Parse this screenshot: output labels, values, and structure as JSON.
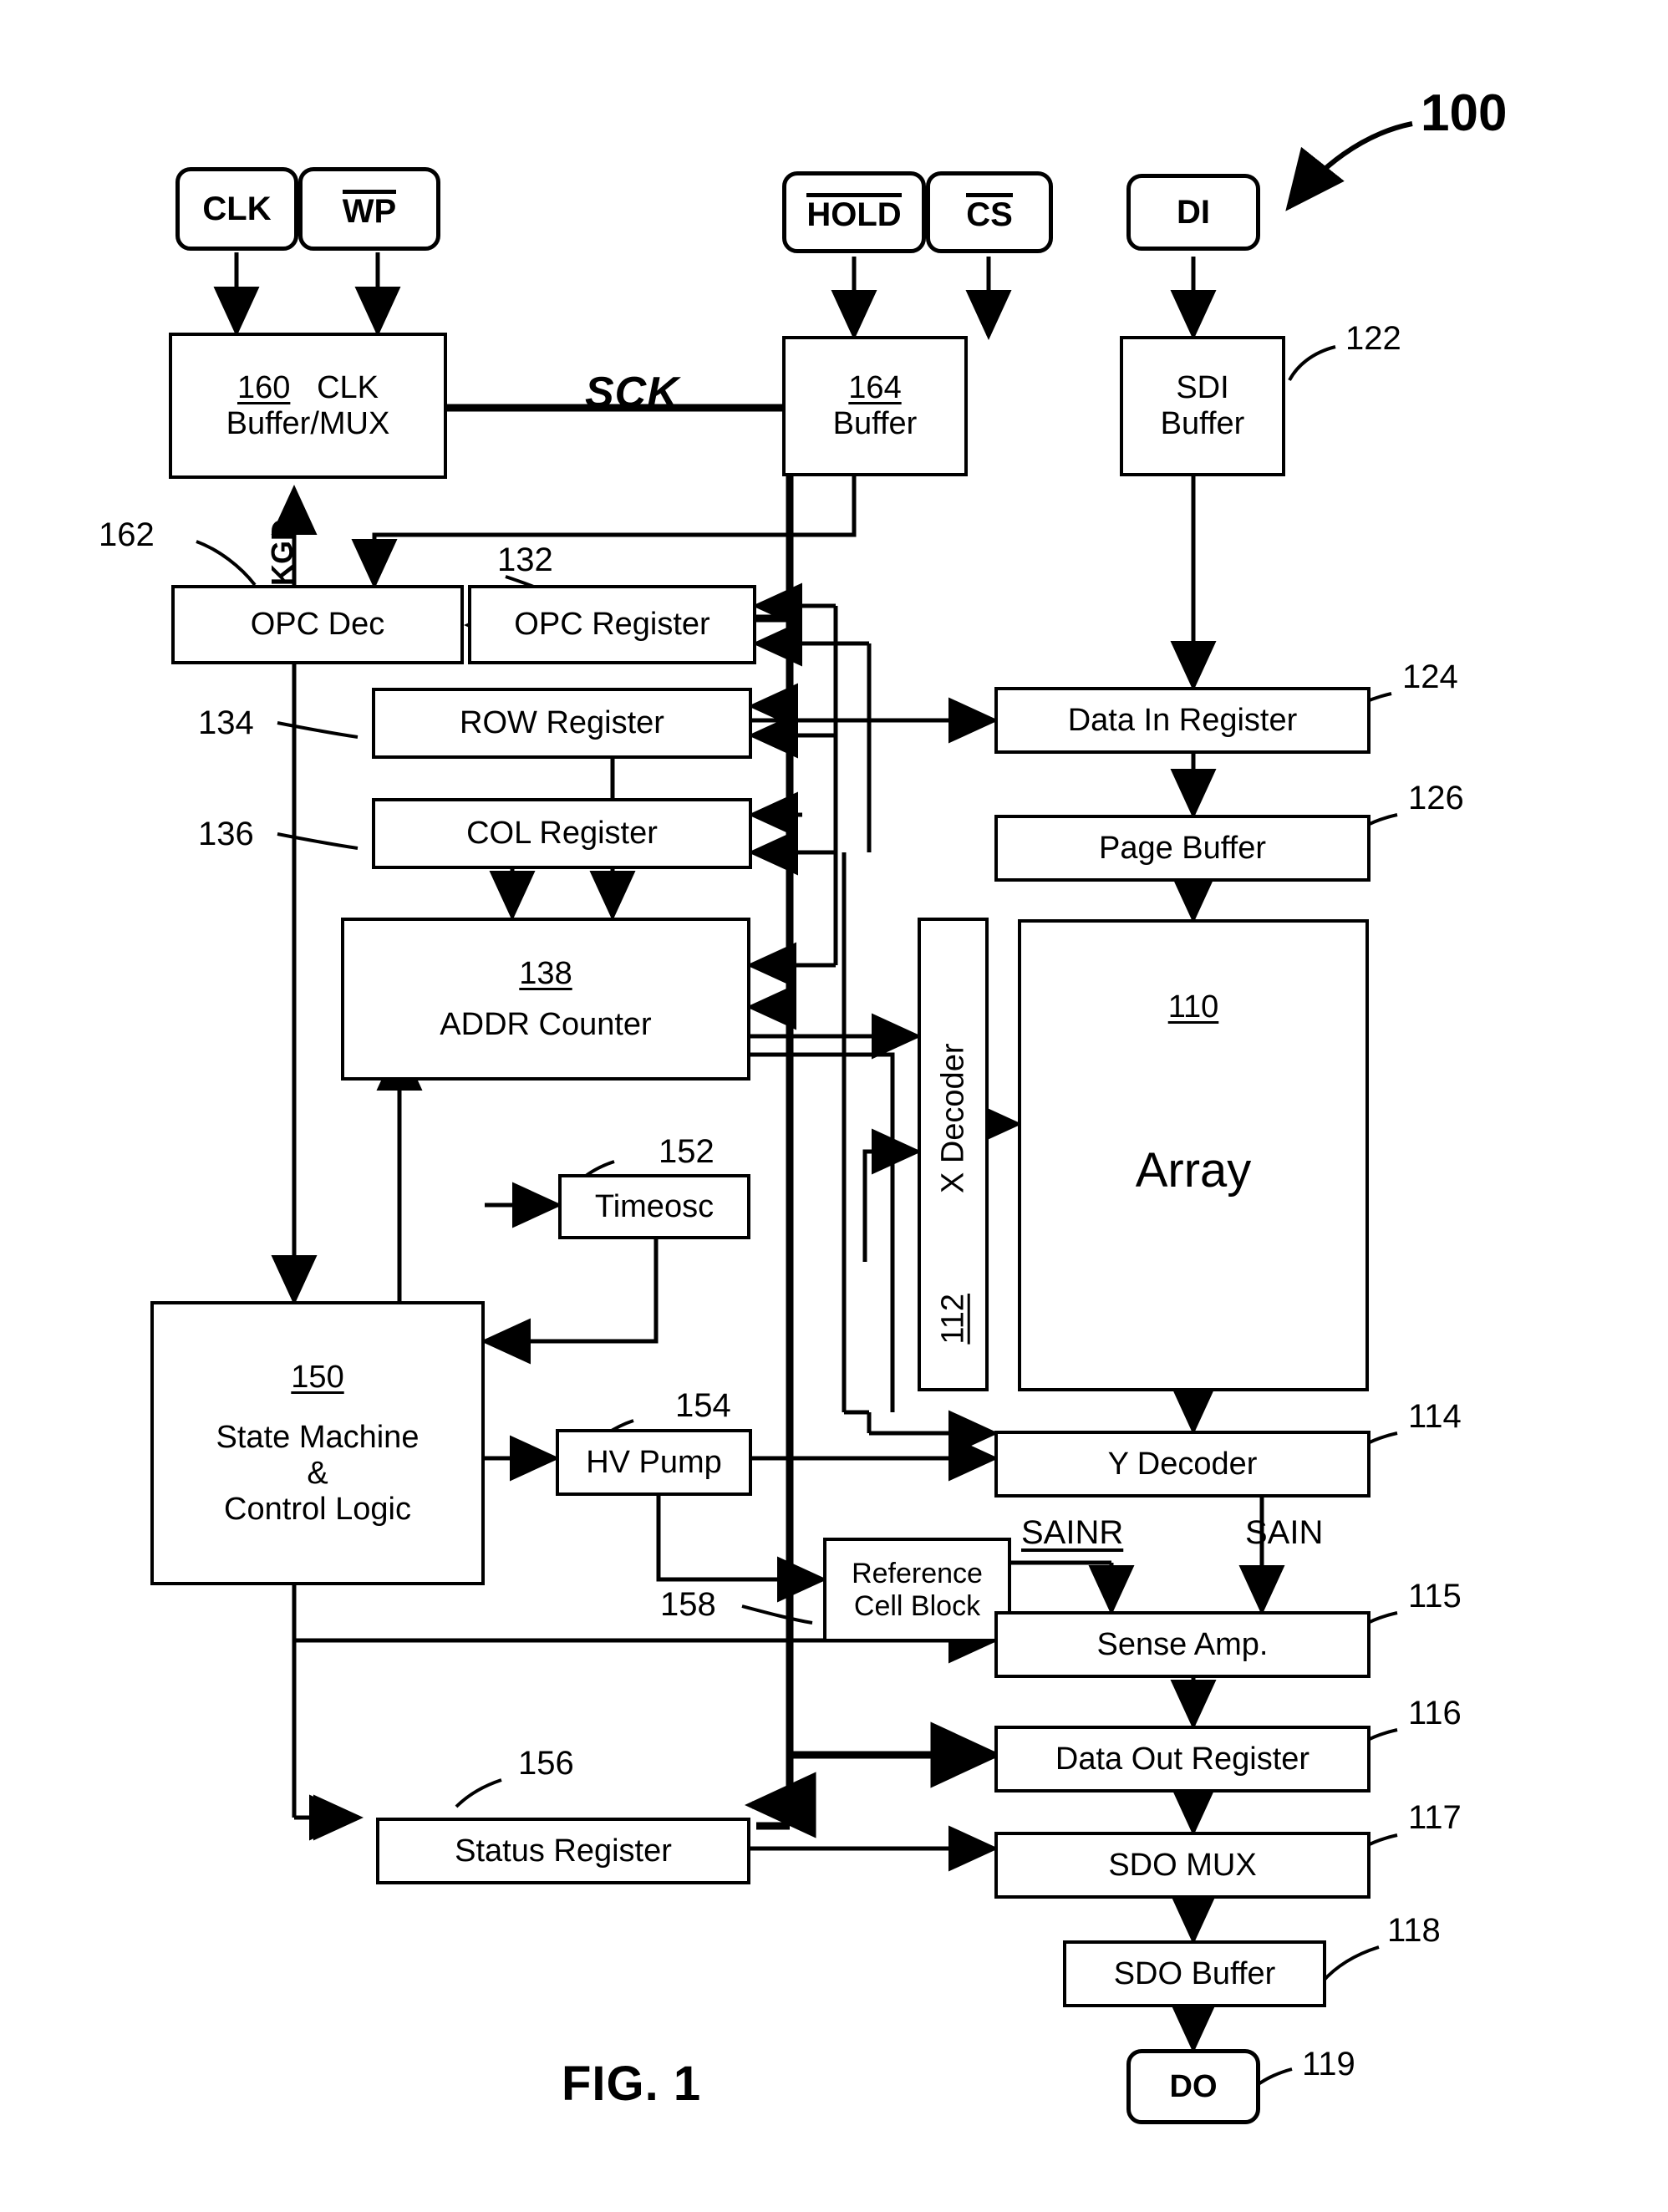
{
  "figure": {
    "caption": "FIG. 1",
    "device_ref": "100"
  },
  "pads": [
    {
      "id": "clk",
      "label": "CLK",
      "overline": false
    },
    {
      "id": "wp",
      "label": "WP",
      "overline": true
    },
    {
      "id": "hold",
      "label": "HOLD",
      "overline": true
    },
    {
      "id": "cs",
      "label": "CS",
      "overline": true
    },
    {
      "id": "di",
      "label": "DI",
      "overline": false
    },
    {
      "id": "do",
      "label": "DO",
      "overline": false,
      "ref": "119"
    }
  ],
  "blocks": {
    "clk_buffer_mux": {
      "ref": "160",
      "line1": "CLK",
      "line2": "Buffer/MUX"
    },
    "hold_buffer": {
      "ref": "164",
      "line2": "Buffer"
    },
    "sdi_buffer": {
      "ref": "122",
      "line1": "SDI",
      "line2": "Buffer"
    },
    "opc_dec": {
      "ref": "162",
      "label": "OPC Dec"
    },
    "opc_register": {
      "ref": "132",
      "label": "OPC Register"
    },
    "row_register": {
      "ref": "134",
      "label": "ROW Register"
    },
    "col_register": {
      "ref": "136",
      "label": "COL Register"
    },
    "addr_counter": {
      "ref": "138",
      "label": "ADDR Counter"
    },
    "data_in_register": {
      "ref": "124",
      "label": "Data In Register"
    },
    "page_buffer": {
      "ref": "126",
      "label": "Page Buffer"
    },
    "array": {
      "ref": "110",
      "label": "Array"
    },
    "x_decoder": {
      "ref": "112",
      "label": "X Decoder"
    },
    "y_decoder": {
      "ref": "114",
      "label": "Y Decoder"
    },
    "timeosc": {
      "ref": "152",
      "label": "Timeosc"
    },
    "state_machine": {
      "ref": "150",
      "line1": "State Machine",
      "line2": "&",
      "line3": "Control Logic"
    },
    "hv_pump": {
      "ref": "154",
      "label": "HV Pump"
    },
    "reference_cell_block": {
      "ref": "158",
      "line1": "Reference",
      "line2": "Cell Block"
    },
    "sense_amp": {
      "ref": "115",
      "label": "Sense Amp."
    },
    "data_out_register": {
      "ref": "116",
      "label": "Data Out Register"
    },
    "sdo_mux": {
      "ref": "117",
      "label": "SDO MUX"
    },
    "sdo_buffer": {
      "ref": "118",
      "label": "SDO Buffer"
    },
    "status_register": {
      "ref": "156",
      "label": "Status Register"
    }
  },
  "signals": {
    "sck": "SCK",
    "kgd": "KGD",
    "sainr": "SAINR",
    "sain": "SAIN"
  }
}
